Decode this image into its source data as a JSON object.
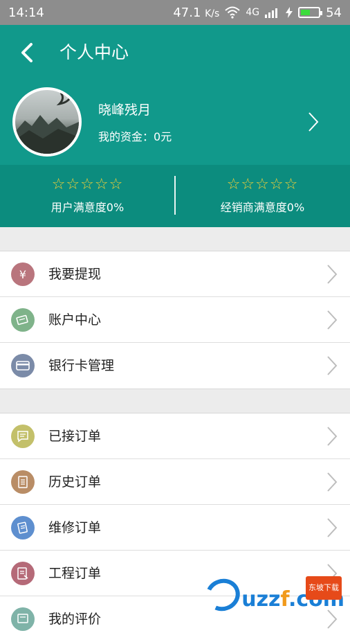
{
  "status_bar": {
    "time": "14:14",
    "network_speed": "47.1",
    "speed_unit": "K/s",
    "signal_type": "4G",
    "battery": "54",
    "battery_level": 0.54
  },
  "header": {
    "title": "个人中心",
    "background_color": "#11998b"
  },
  "profile": {
    "username": "晓峰残月",
    "funds_label": "我的资金：",
    "funds_value": "0元"
  },
  "ratings": [
    {
      "stars": "☆☆☆☆☆",
      "label": "用户满意度0%"
    },
    {
      "stars": "☆☆☆☆☆",
      "label": "经销商满意度0%"
    }
  ],
  "menu_group_1": [
    {
      "label": "我要提现",
      "icon": "withdraw-icon",
      "color": "#b9757d"
    },
    {
      "label": "账户中心",
      "icon": "account-icon",
      "color": "#7fb38a"
    },
    {
      "label": "银行卡管理",
      "icon": "bank-card-icon",
      "color": "#7b8ba8"
    }
  ],
  "menu_group_2": [
    {
      "label": "已接订单",
      "icon": "accepted-order-icon",
      "color": "#c3c06a"
    },
    {
      "label": "历史订单",
      "icon": "history-order-icon",
      "color": "#b98d66"
    },
    {
      "label": "维修订单",
      "icon": "repair-order-icon",
      "color": "#5e8fcf"
    },
    {
      "label": "工程订单",
      "icon": "project-order-icon",
      "color": "#b56a78"
    },
    {
      "label": "我的评价",
      "icon": "review-icon",
      "color": "#7fb3a8"
    }
  ],
  "watermark": {
    "text_main": "uzz",
    "text_accent": "f",
    "text_suffix": ".com",
    "tag": "东坡下载"
  }
}
